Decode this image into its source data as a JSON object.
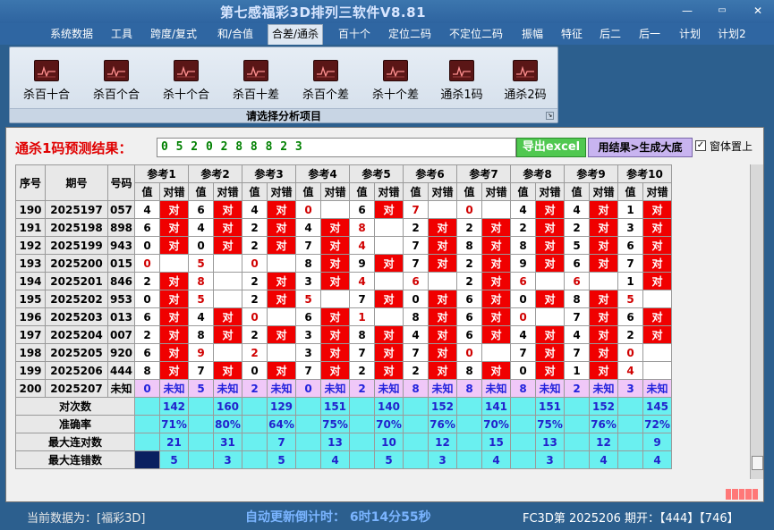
{
  "window": {
    "title": "第七感福彩3D排列三软件V8.81",
    "minimize": "—",
    "restore": "▭",
    "close": "✕"
  },
  "menu": [
    "系统数据",
    "工具",
    "跨度/复式",
    "和/合值",
    "合差/通杀",
    "百十个",
    "定位二码",
    "不定位二码",
    "振幅",
    "特征",
    "后二",
    "后一",
    "计划",
    "计划2"
  ],
  "menu_active_index": 4,
  "ribbon": {
    "buttons": [
      "杀百十合",
      "杀百个合",
      "杀十个合",
      "杀百十差",
      "杀百个差",
      "杀十个差",
      "通杀1码",
      "通杀2码"
    ],
    "caption": "请选择分析项目",
    "icon": "chart-icon"
  },
  "result": {
    "label": "通杀1码预测结果：",
    "value": "0 5 2 0 2 8 8 8 2 3",
    "export_button": "导出excel",
    "generate_button": "用结果>生成大底",
    "topmost_label": "窗体置上",
    "topmost_checked": true
  },
  "table": {
    "headers": {
      "seq": "序号",
      "issue": "期号",
      "code": "号码",
      "refs": [
        "参考1",
        "参考2",
        "参考3",
        "参考4",
        "参考5",
        "参考6",
        "参考7",
        "参考8",
        "参考9",
        "参考10"
      ],
      "val": "值",
      "hit": "对错"
    },
    "hit_text": "对",
    "unknown_text": "未知",
    "rows": [
      {
        "seq": "190",
        "issue": "2025197",
        "code": "057",
        "vals": [
          "4",
          "6",
          "4",
          "0",
          "6",
          "7",
          "0",
          "4",
          "4",
          "1"
        ],
        "hits": [
          1,
          1,
          1,
          0,
          1,
          0,
          0,
          1,
          1,
          1
        ]
      },
      {
        "seq": "191",
        "issue": "2025198",
        "code": "898",
        "vals": [
          "6",
          "4",
          "2",
          "4",
          "8",
          "2",
          "2",
          "2",
          "2",
          "3"
        ],
        "hits": [
          1,
          1,
          1,
          1,
          0,
          1,
          1,
          1,
          1,
          1
        ]
      },
      {
        "seq": "192",
        "issue": "2025199",
        "code": "943",
        "vals": [
          "0",
          "0",
          "2",
          "7",
          "4",
          "7",
          "8",
          "8",
          "5",
          "6"
        ],
        "hits": [
          1,
          1,
          1,
          1,
          0,
          1,
          1,
          1,
          1,
          1
        ]
      },
      {
        "seq": "193",
        "issue": "2025200",
        "code": "015",
        "vals": [
          "0",
          "5",
          "0",
          "8",
          "9",
          "7",
          "2",
          "9",
          "6",
          "7"
        ],
        "hits": [
          0,
          0,
          0,
          1,
          1,
          1,
          1,
          1,
          1,
          1
        ]
      },
      {
        "seq": "194",
        "issue": "2025201",
        "code": "846",
        "vals": [
          "2",
          "8",
          "2",
          "3",
          "4",
          "6",
          "2",
          "6",
          "6",
          "1"
        ],
        "hits": [
          1,
          0,
          1,
          1,
          0,
          0,
          1,
          0,
          0,
          1
        ]
      },
      {
        "seq": "195",
        "issue": "2025202",
        "code": "953",
        "vals": [
          "0",
          "5",
          "2",
          "5",
          "7",
          "0",
          "6",
          "0",
          "8",
          "5"
        ],
        "hits": [
          1,
          0,
          1,
          0,
          1,
          1,
          1,
          1,
          1,
          0
        ]
      },
      {
        "seq": "196",
        "issue": "2025203",
        "code": "013",
        "vals": [
          "6",
          "4",
          "0",
          "6",
          "1",
          "8",
          "6",
          "0",
          "7",
          "6"
        ],
        "hits": [
          1,
          1,
          0,
          1,
          0,
          1,
          1,
          0,
          1,
          1
        ]
      },
      {
        "seq": "197",
        "issue": "2025204",
        "code": "007",
        "vals": [
          "2",
          "8",
          "2",
          "3",
          "8",
          "4",
          "6",
          "4",
          "4",
          "2"
        ],
        "hits": [
          1,
          1,
          1,
          1,
          1,
          1,
          1,
          1,
          1,
          1
        ]
      },
      {
        "seq": "198",
        "issue": "2025205",
        "code": "920",
        "vals": [
          "6",
          "9",
          "2",
          "3",
          "7",
          "7",
          "0",
          "7",
          "7",
          "0"
        ],
        "hits": [
          1,
          0,
          0,
          1,
          1,
          1,
          0,
          1,
          1,
          0
        ]
      },
      {
        "seq": "199",
        "issue": "2025206",
        "code": "444",
        "vals": [
          "8",
          "7",
          "0",
          "7",
          "2",
          "2",
          "8",
          "0",
          "1",
          "4"
        ],
        "hits": [
          1,
          1,
          1,
          1,
          1,
          1,
          1,
          1,
          1,
          0
        ]
      }
    ],
    "red_value_cells": [
      [
        0,
        3
      ],
      [
        0,
        5
      ],
      [
        0,
        6
      ],
      [
        1,
        4
      ],
      [
        2,
        4
      ],
      [
        3,
        0
      ],
      [
        3,
        1
      ],
      [
        3,
        2
      ],
      [
        4,
        1
      ],
      [
        4,
        4
      ],
      [
        4,
        5
      ],
      [
        4,
        7
      ],
      [
        4,
        8
      ],
      [
        5,
        1
      ],
      [
        5,
        3
      ],
      [
        5,
        9
      ],
      [
        6,
        2
      ],
      [
        6,
        4
      ],
      [
        6,
        7
      ],
      [
        8,
        1
      ],
      [
        8,
        2
      ],
      [
        8,
        6
      ],
      [
        8,
        9
      ],
      [
        9,
        9
      ]
    ],
    "pending_row": {
      "seq": "200",
      "issue": "2025207",
      "code": "未知",
      "vals": [
        "0",
        "5",
        "2",
        "0",
        "2",
        "8",
        "8",
        "8",
        "2",
        "3"
      ]
    },
    "stats": [
      {
        "label": "对次数",
        "values": [
          "142",
          "160",
          "129",
          "151",
          "140",
          "152",
          "141",
          "151",
          "152",
          "145"
        ]
      },
      {
        "label": "准确率",
        "values": [
          "71%",
          "80%",
          "64%",
          "75%",
          "70%",
          "76%",
          "70%",
          "75%",
          "76%",
          "72%"
        ]
      },
      {
        "label": "最大连对数",
        "values": [
          "21",
          "31",
          "7",
          "13",
          "10",
          "12",
          "15",
          "13",
          "12",
          "9"
        ]
      },
      {
        "label": "最大连错数",
        "values": [
          "5",
          "3",
          "5",
          "4",
          "5",
          "3",
          "4",
          "3",
          "4",
          "4"
        ]
      }
    ]
  },
  "status": {
    "current_data": "当前数据为：[福彩3D]",
    "countdown": "自动更新倒计时：  6时14分55秒",
    "draw_info": "FC3D第 2025206 期开：【444】【746】"
  }
}
